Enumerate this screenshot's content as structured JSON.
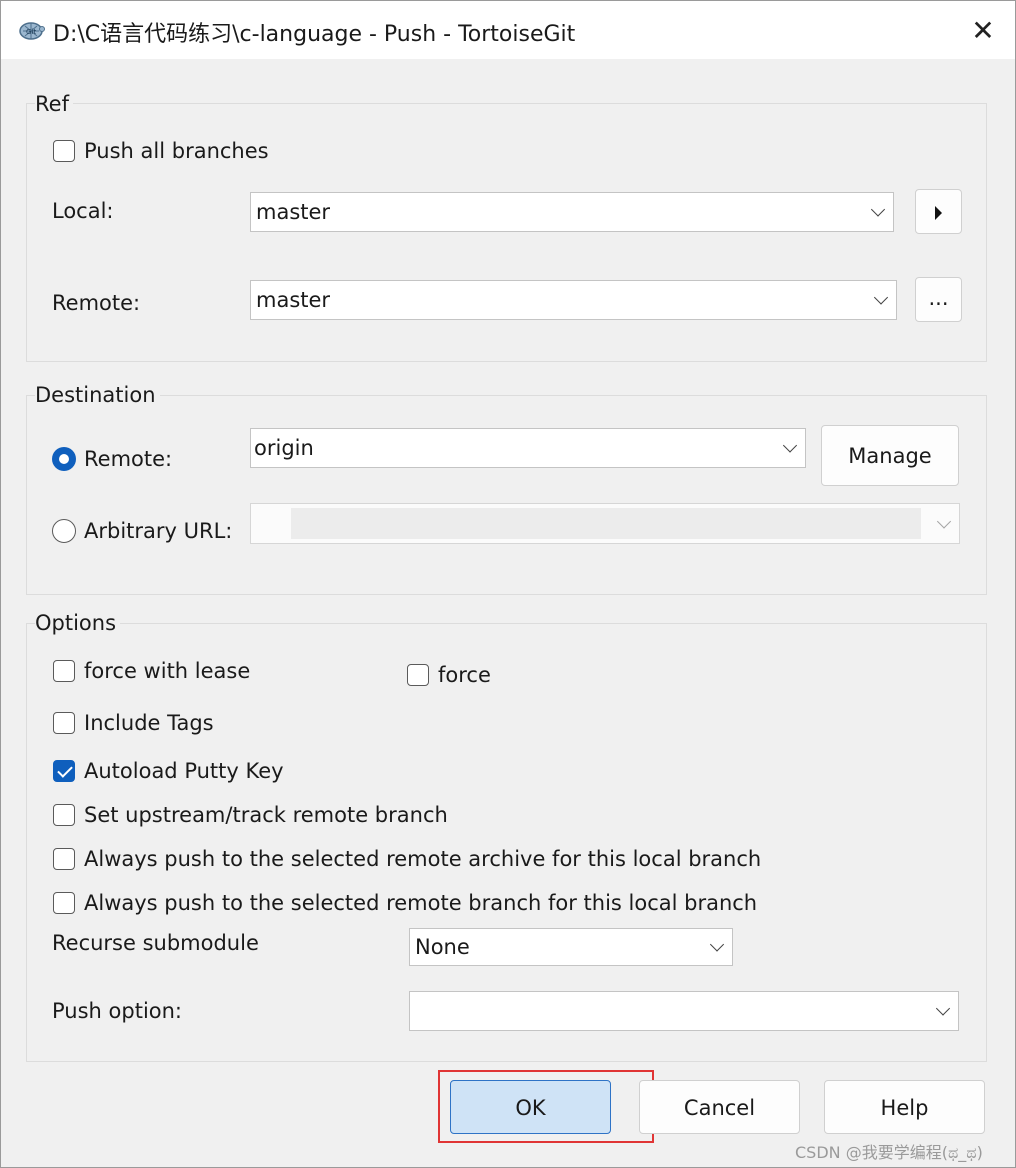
{
  "window": {
    "title": "D:\\C语言代码练习\\c-language - Push - TortoiseGit",
    "close_glyph": "✕",
    "icon_name": "tortoisegit-icon"
  },
  "ref": {
    "legend": "Ref",
    "push_all_label": "Push all branches",
    "push_all_checked": false,
    "local_label": "Local:",
    "local_value": "master",
    "local_action_icon": "triangle-right-icon",
    "remote_label": "Remote:",
    "remote_value": "master",
    "remote_browse_label": "..."
  },
  "destination": {
    "legend": "Destination",
    "remote_label": "Remote:",
    "remote_selected": true,
    "remote_value": "origin",
    "manage_label": "Manage",
    "arbitrary_label": "Arbitrary URL:",
    "arbitrary_selected": false,
    "arbitrary_value": ""
  },
  "options": {
    "legend": "Options",
    "force_with_lease_label": "force with lease",
    "force_with_lease_checked": false,
    "force_label": "force",
    "force_checked": false,
    "include_tags_label": "Include Tags",
    "include_tags_checked": false,
    "autoload_label": "Autoload Putty Key",
    "autoload_checked": true,
    "upstream_label": "Set upstream/track remote branch",
    "upstream_checked": false,
    "always_archive_label": "Always push to the selected remote archive for this local branch",
    "always_archive_checked": false,
    "always_branch_label": "Always push to the selected remote branch for this local branch",
    "always_branch_checked": false,
    "recurse_label": "Recurse submodule",
    "recurse_value": "None",
    "push_option_label": "Push option:",
    "push_option_value": ""
  },
  "buttons": {
    "ok_label": "OK",
    "cancel_label": "Cancel",
    "help_label": "Help"
  },
  "annotation": {
    "highlight_color": "#e03535"
  },
  "watermark": "CSDN @我要学编程(ಥ_ಥ)",
  "colors": {
    "accent": "#0f5fbd",
    "window_bg": "#f0f0f0",
    "primary_button_bg": "#cfe3f6"
  }
}
